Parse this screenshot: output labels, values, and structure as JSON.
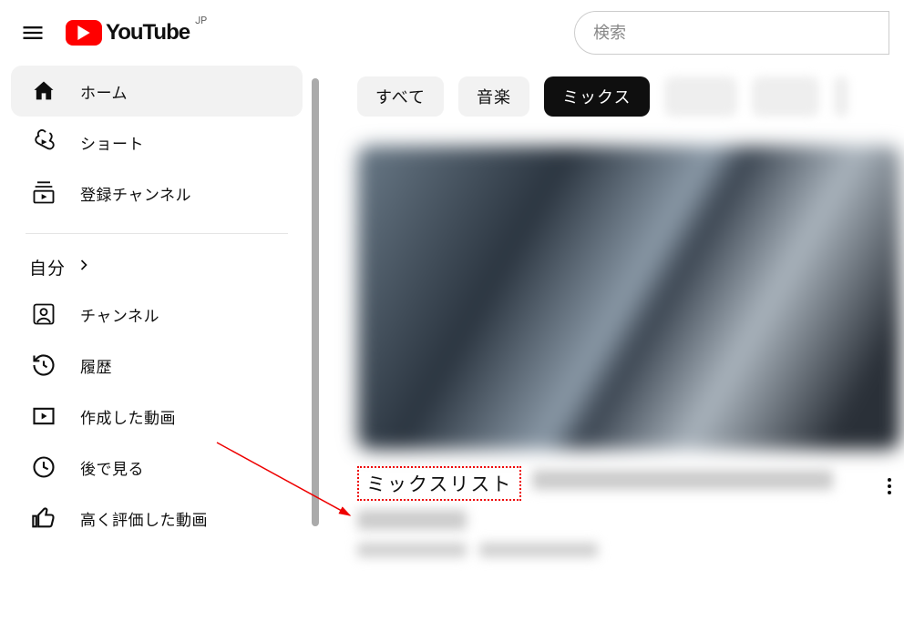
{
  "header": {
    "logo_text": "YouTube",
    "country_code": "JP",
    "search_placeholder": "検索"
  },
  "sidebar": {
    "primary": [
      {
        "label": "ホーム",
        "icon": "home",
        "active": true
      },
      {
        "label": "ショート",
        "icon": "shorts",
        "active": false
      },
      {
        "label": "登録チャンネル",
        "icon": "subscriptions",
        "active": false
      }
    ],
    "you_section_label": "自分",
    "you_items": [
      {
        "label": "チャンネル",
        "icon": "channel"
      },
      {
        "label": "履歴",
        "icon": "history"
      },
      {
        "label": "作成した動画",
        "icon": "your-videos"
      },
      {
        "label": "後で見る",
        "icon": "watch-later"
      },
      {
        "label": "高く評価した動画",
        "icon": "liked"
      }
    ]
  },
  "chips": [
    {
      "label": "すべて",
      "active": false
    },
    {
      "label": "音楽",
      "active": false
    },
    {
      "label": "ミックス",
      "active": true
    }
  ],
  "annotation": {
    "mix_label": "ミックスリスト"
  }
}
